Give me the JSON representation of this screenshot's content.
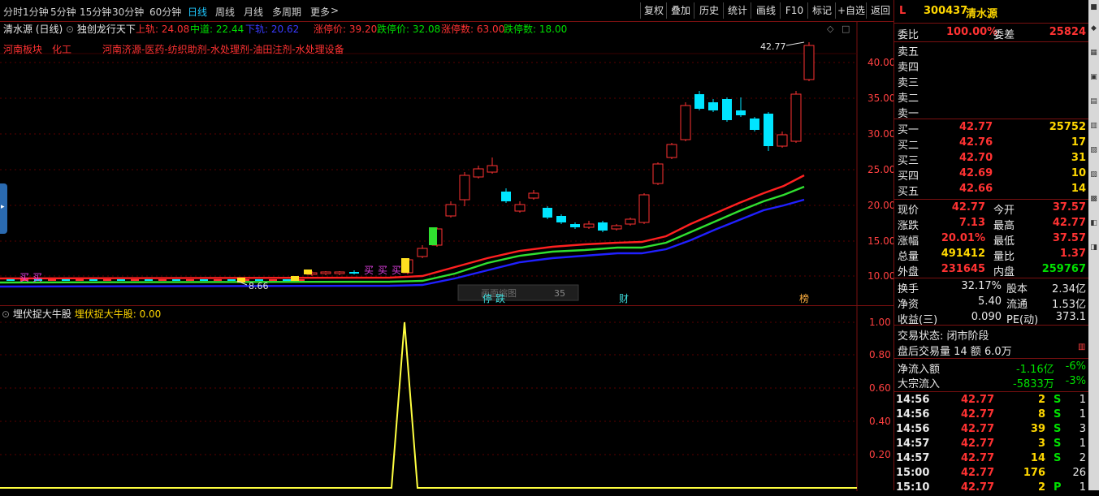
{
  "toolbar": {
    "periods": [
      "分时",
      "1分钟",
      "5分钟",
      "15分钟",
      "30分钟",
      "60分钟",
      "日线",
      "周线",
      "月线",
      "多周期",
      "更多"
    ],
    "active": "日线",
    "more_arrow": ">",
    "buttons": [
      "复权",
      "叠加",
      "历史",
      "统计",
      "画线",
      "F10",
      "标记",
      "+自选",
      "返回"
    ]
  },
  "main_header": {
    "stock_title": "清水源 (日线)",
    "indicator_name": "独创龙行天下",
    "upper_label": "上轨: 24.08",
    "mid_label": "中道: 22.44",
    "lower_label": "下轨: 20.62",
    "limit_up_price": "涨停价: 39.20",
    "limit_down_price": "跌停价: 32.08",
    "limit_up_count": "涨停数: 63.00",
    "limit_down_count": "跌停数: 18.00"
  },
  "sector_line": {
    "region": "河南板块",
    "industry": "化工",
    "concepts": "河南济源-医药-纺织助剂-水处理剂-油田注剂-水处理设备"
  },
  "price_axis": [
    "40.00",
    "35.00",
    "30.00",
    "25.00",
    "20.00",
    "15.00",
    "10.00"
  ],
  "annotations": {
    "high_marker": "42.77",
    "low_marker": "8.66",
    "buy_labels": [
      "买",
      "买",
      "买",
      "买",
      "买"
    ],
    "stop_label": "停",
    "fall_label": "跌",
    "finance_label": "财",
    "list_label": "榜",
    "overlay_box_text": "画面缩图",
    "overlay_box_num": "35"
  },
  "sub_header": {
    "indicator_name": "埋伏捉大牛股",
    "value_label": "埋伏捉大牛股: 0.00"
  },
  "sub_axis": [
    "1.00",
    "0.80",
    "0.60",
    "0.40",
    "0.20"
  ],
  "info": {
    "code": "300437",
    "name": "清水源",
    "prefix": "L",
    "weibi_label": "委比",
    "weibi": "100.00%",
    "weicha_label": "委差",
    "weicha": "25824",
    "sell": [
      {
        "label": "卖五",
        "price": "",
        "vol": ""
      },
      {
        "label": "卖四",
        "price": "",
        "vol": ""
      },
      {
        "label": "卖三",
        "price": "",
        "vol": ""
      },
      {
        "label": "卖二",
        "price": "",
        "vol": ""
      },
      {
        "label": "卖一",
        "price": "",
        "vol": ""
      }
    ],
    "buy": [
      {
        "label": "买一",
        "price": "42.77",
        "vol": "25752"
      },
      {
        "label": "买二",
        "price": "42.76",
        "vol": "17"
      },
      {
        "label": "买三",
        "price": "42.70",
        "vol": "31"
      },
      {
        "label": "买四",
        "price": "42.69",
        "vol": "10"
      },
      {
        "label": "买五",
        "price": "42.66",
        "vol": "14"
      }
    ],
    "quote": [
      {
        "l1": "现价",
        "v1": "42.77",
        "l2": "今开",
        "v2": "37.57"
      },
      {
        "l1": "涨跌",
        "v1": "7.13",
        "l2": "最高",
        "v2": "42.77"
      },
      {
        "l1": "涨幅",
        "v1": "20.01%",
        "l2": "最低",
        "v2": "37.57"
      },
      {
        "l1": "总量",
        "v1": "491412",
        "l2": "量比",
        "v2": "1.37"
      },
      {
        "l1": "外盘",
        "v1": "231645",
        "l2": "内盘",
        "v2": "259767"
      }
    ],
    "stats": [
      {
        "l1": "换手",
        "v1": "32.17%",
        "l2": "股本",
        "v2": "2.34亿"
      },
      {
        "l1": "净资",
        "v1": "5.40",
        "l2": "流通",
        "v2": "1.53亿"
      },
      {
        "l1": "收益(三)",
        "v1": "0.090",
        "l2": "PE(动)",
        "v2": "373.1"
      }
    ],
    "trade_status": "交易状态: 闭市阶段",
    "after_hours": "盘后交易量 14 额 6.0万",
    "net_inflow_label": "净流入额",
    "net_inflow": "-1.16亿",
    "net_inflow_pct": "-6%",
    "block_inflow_label": "大宗流入",
    "block_inflow": "-5833万",
    "block_inflow_pct": "-3%",
    "ticks": [
      {
        "time": "14:56",
        "price": "42.77",
        "vol": "2",
        "side": "S",
        "n": "1"
      },
      {
        "time": "14:56",
        "price": "42.77",
        "vol": "8",
        "side": "S",
        "n": "1"
      },
      {
        "time": "14:56",
        "price": "42.77",
        "vol": "39",
        "side": "S",
        "n": "3"
      },
      {
        "time": "14:57",
        "price": "42.77",
        "vol": "3",
        "side": "S",
        "n": "1"
      },
      {
        "time": "14:57",
        "price": "42.77",
        "vol": "14",
        "side": "S",
        "n": "2"
      },
      {
        "time": "15:00",
        "price": "42.77",
        "vol": "176",
        "side": "",
        "n": "26"
      },
      {
        "time": "15:10",
        "price": "42.77",
        "vol": "2",
        "side": "P",
        "n": "1"
      }
    ]
  },
  "colors": {
    "up": "#ff3232",
    "down": "#00e5ff",
    "upper_band": "#ff2020",
    "mid_band": "#30e030",
    "lower_band": "#2020ff",
    "signal": "#ffff40"
  }
}
